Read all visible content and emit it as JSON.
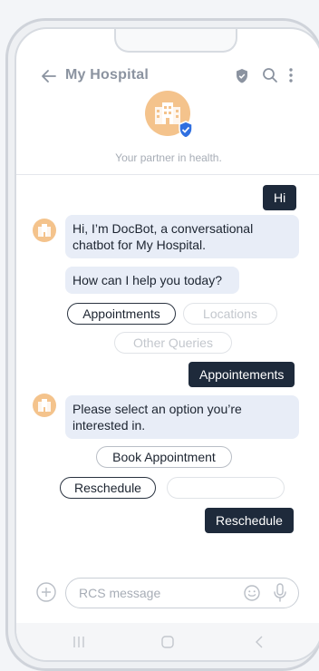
{
  "header": {
    "title": "My Hospital",
    "tagline": "Your partner in health."
  },
  "messages": {
    "sent_hi": "Hi",
    "bot_intro": "Hi, I’m DocBot, a conversational chatbot for My Hospital.",
    "bot_help": "How can I help you today?",
    "sent_appointments": "Appointements",
    "bot_select": "Please select an option you’re interested in.",
    "sent_reschedule": "Reschedule"
  },
  "chips1": {
    "appointments": "Appointments",
    "locations": "Locations",
    "other": "Other Queries"
  },
  "chips2": {
    "book": "Book Appointment",
    "reschedule": "Reschedule",
    "empty": ""
  },
  "composer": {
    "placeholder": "RCS message"
  },
  "colors": {
    "accent_dark": "#1e2a3b",
    "bubble_recv": "#e8edf7",
    "avatar_orange": "#f4c38c",
    "verified_blue": "#2f6fe0"
  },
  "icons": [
    "back-arrow-icon",
    "shield-icon",
    "search-icon",
    "kebab-menu-icon",
    "hospital-icon",
    "verified-badge-icon",
    "plus-icon",
    "emoji-icon",
    "mic-icon",
    "nav-recents-icon",
    "nav-home-icon",
    "nav-back-icon"
  ]
}
